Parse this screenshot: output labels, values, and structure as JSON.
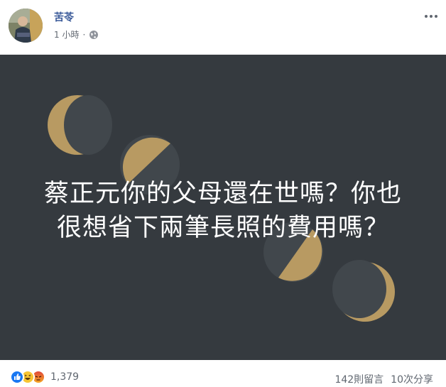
{
  "post": {
    "author": "苦苓",
    "time": "1 小時",
    "separator": "·",
    "privacy_icon": "globe-icon",
    "menu_icon": "more-options-icon"
  },
  "image": {
    "background_color": "#353a3f",
    "accent_color": "#b89a62",
    "text_lines": [
      "蔡正元你的父母還在世嗎？你也",
      "很想省下兩筆長照的費用嗎？"
    ]
  },
  "footer": {
    "reaction_icons": [
      "like-icon",
      "haha-icon",
      "angry-icon"
    ],
    "reaction_count": "1,379",
    "comments": "142則留言",
    "shares": "10次分享"
  }
}
